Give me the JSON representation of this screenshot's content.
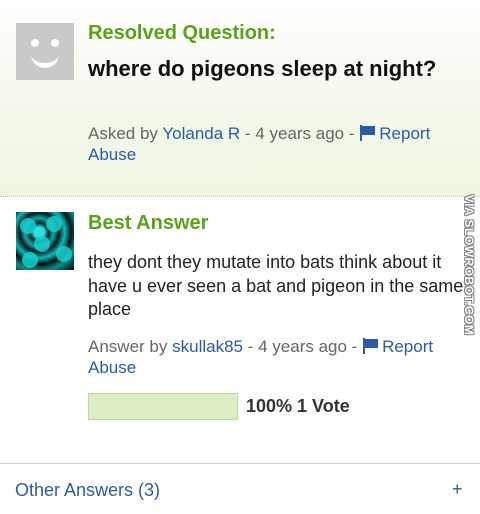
{
  "question": {
    "status_label": "Resolved Question:",
    "title": "where do pigeons sleep at night?",
    "asked_prefix": "Asked by",
    "asker": "Yolanda R",
    "time": "- 4 years ago -",
    "report_label": "Report Abuse"
  },
  "answer": {
    "label": "Best Answer",
    "text": "they dont they mutate into bats think about it have u ever seen a bat and pigeon in the same place",
    "answered_prefix": "Answer by",
    "answerer": "skullak85",
    "time": "- 4 years ago -",
    "report_label": "Report Abuse",
    "vote_percent": 100,
    "vote_text": "100% 1 Vote"
  },
  "other_answers": {
    "label": "Other Answers (3)",
    "expand": "+"
  },
  "watermark": "VIA SLOWROBOT.COM",
  "colors": {
    "green_heading": "#5aa319",
    "link_blue": "#2d5aa8",
    "vote_fill": "#ddedc4"
  }
}
